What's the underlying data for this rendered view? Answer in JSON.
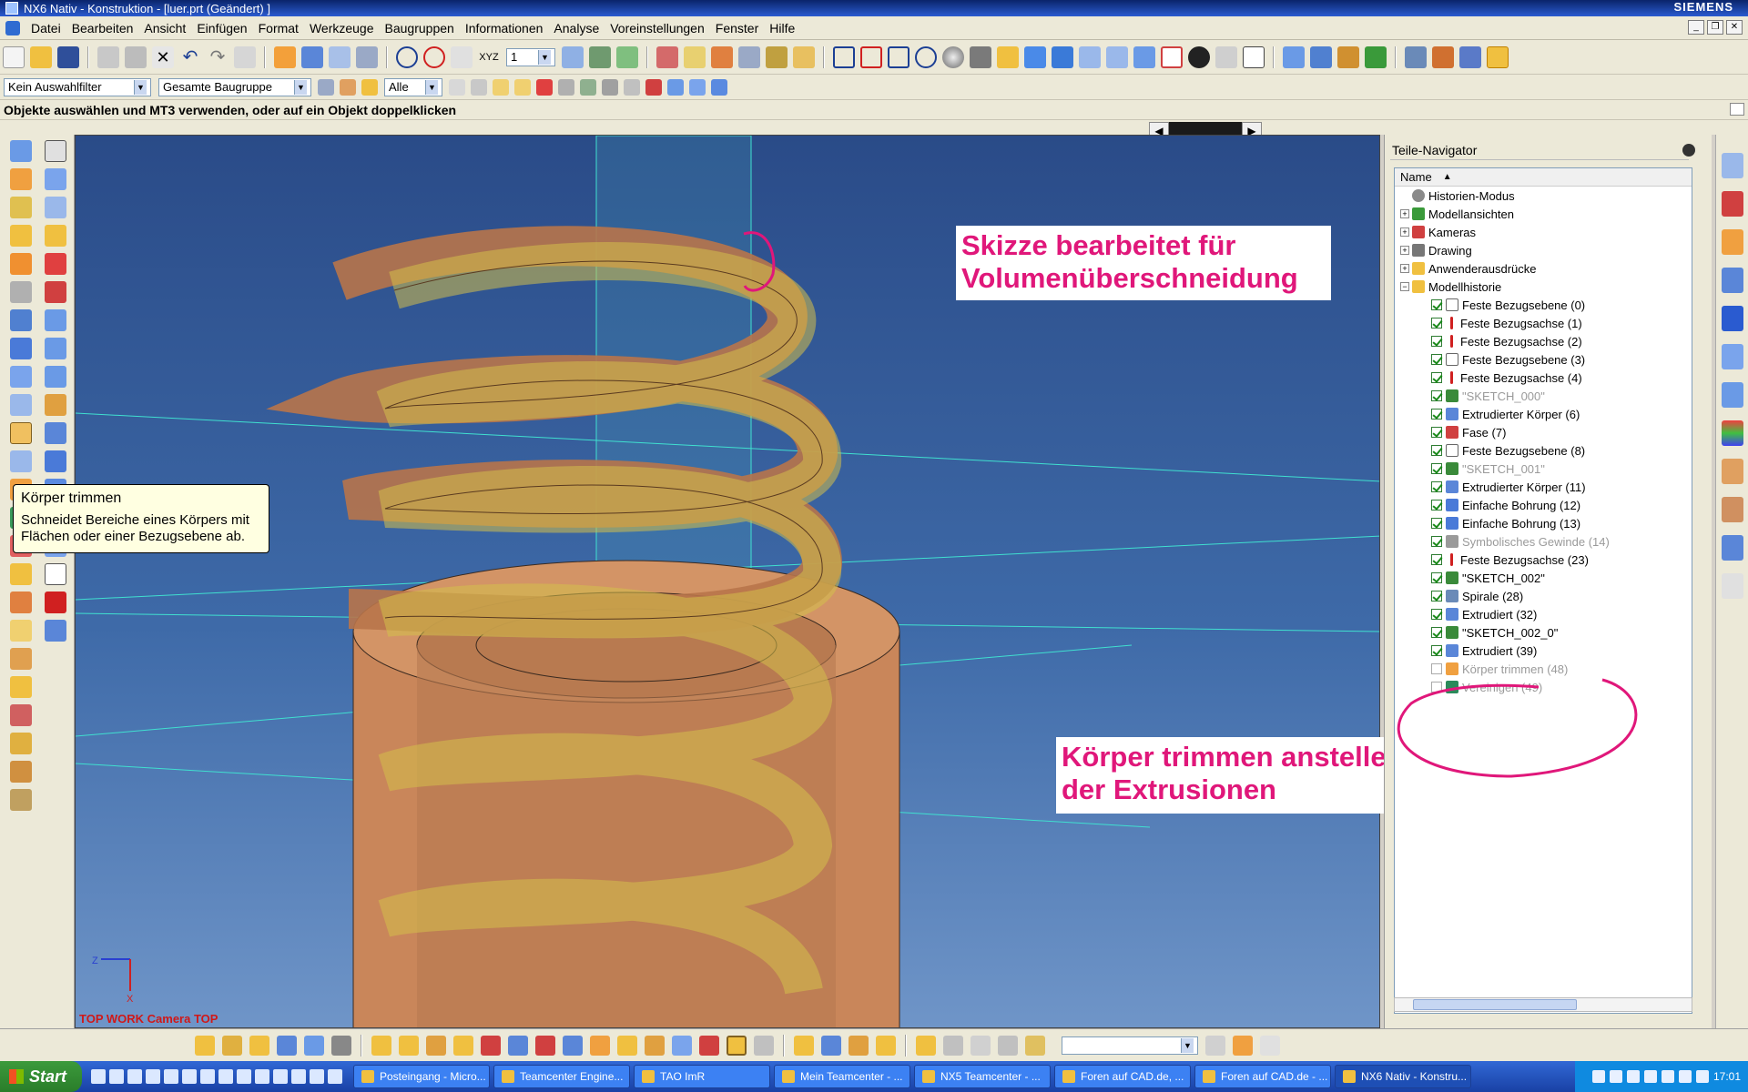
{
  "window": {
    "title": "NX6 Nativ - Konstruktion - [luer.prt (Geändert) ]",
    "brand": "SIEMENS"
  },
  "menu": [
    "Datei",
    "Bearbeiten",
    "Ansicht",
    "Einfügen",
    "Format",
    "Werkzeuge",
    "Baugruppen",
    "Informationen",
    "Analyse",
    "Voreinstellungen",
    "Fenster",
    "Hilfe"
  ],
  "selection_bar": {
    "filter": "Kein Auswahlfilter",
    "scope": "Gesamte Baugruppe",
    "type": "Alle",
    "layer": "1"
  },
  "cue_line": "Objekte auswählen und MT3 verwenden, oder auf ein Objekt doppelklicken",
  "tooltip": {
    "title": "Körper trimmen",
    "body": "Schneidet Bereiche eines Körpers mit Flächen oder einer Bezugsebene ab."
  },
  "viewport": {
    "view_label": "TOP WORK Camera TOP",
    "triad_z": "Z",
    "triad_x": "X"
  },
  "annotations": {
    "note1": "Skizze bearbeitet für Volumenüberschneidung",
    "note2": "Körper trimmen anstelle der Extrusionen",
    "highlight_color": "#e0177a"
  },
  "navigator": {
    "title": "Teile-Navigator",
    "column": "Name",
    "roots": [
      {
        "label": "Historien-Modus",
        "icon": "clock-icon"
      },
      {
        "label": "Modellansichten",
        "icon": "views-icon"
      },
      {
        "label": "Kameras",
        "icon": "camera-icon"
      },
      {
        "label": "Drawing",
        "icon": "drawing-icon"
      },
      {
        "label": "Anwenderausdrücke",
        "icon": "folder-icon"
      },
      {
        "label": "Modellhistorie",
        "icon": "folder-icon"
      }
    ],
    "history": [
      {
        "label": "Feste Bezugsebene (0)",
        "icon": "datum-plane-icon",
        "checked": true,
        "dim": false
      },
      {
        "label": "Feste Bezugsachse (1)",
        "icon": "datum-axis-icon",
        "checked": true,
        "dim": false
      },
      {
        "label": "Feste Bezugsachse (2)",
        "icon": "datum-axis-icon",
        "checked": true,
        "dim": false
      },
      {
        "label": "Feste Bezugsebene (3)",
        "icon": "datum-plane-icon",
        "checked": true,
        "dim": false
      },
      {
        "label": "Feste Bezugsachse (4)",
        "icon": "datum-axis-icon",
        "checked": true,
        "dim": false
      },
      {
        "label": "\"SKETCH_000\"",
        "icon": "sketch-icon",
        "checked": true,
        "dim": true
      },
      {
        "label": "Extrudierter Körper (6)",
        "icon": "extrude-icon",
        "checked": true,
        "dim": false
      },
      {
        "label": "Fase (7)",
        "icon": "chamfer-icon",
        "checked": true,
        "dim": false
      },
      {
        "label": "Feste Bezugsebene (8)",
        "icon": "datum-plane-icon",
        "checked": true,
        "dim": false
      },
      {
        "label": "\"SKETCH_001\"",
        "icon": "sketch-icon",
        "checked": true,
        "dim": true
      },
      {
        "label": "Extrudierter Körper (11)",
        "icon": "extrude-icon",
        "checked": true,
        "dim": false
      },
      {
        "label": "Einfache Bohrung (12)",
        "icon": "hole-icon",
        "checked": true,
        "dim": false
      },
      {
        "label": "Einfache Bohrung (13)",
        "icon": "hole-icon",
        "checked": true,
        "dim": false
      },
      {
        "label": "Symbolisches Gewinde (14)",
        "icon": "thread-icon",
        "checked": true,
        "dim": true
      },
      {
        "label": "Feste Bezugsachse (23)",
        "icon": "datum-axis-icon",
        "checked": true,
        "dim": false
      },
      {
        "label": "\"SKETCH_002\"",
        "icon": "sketch-icon",
        "checked": true,
        "dim": false
      },
      {
        "label": "Spirale (28)",
        "icon": "helix-icon",
        "checked": true,
        "dim": false
      },
      {
        "label": "Extrudiert (32)",
        "icon": "extrude-icon",
        "checked": true,
        "dim": false
      },
      {
        "label": "\"SKETCH_002_0\"",
        "icon": "sketch-icon",
        "checked": true,
        "dim": false
      },
      {
        "label": "Extrudiert (39)",
        "icon": "extrude-icon",
        "checked": true,
        "dim": false
      },
      {
        "label": "Körper trimmen (48)",
        "icon": "trim-body-icon",
        "checked": false,
        "dim": true
      },
      {
        "label": "Vereinigen (49)",
        "icon": "unite-icon",
        "checked": false,
        "dim": true
      }
    ]
  },
  "taskbar": {
    "start": "Start",
    "tasks": [
      {
        "label": "Posteingang - Micro...",
        "active": false
      },
      {
        "label": "Teamcenter Engine...",
        "active": false
      },
      {
        "label": "TAO ImR",
        "active": false
      },
      {
        "label": "Mein Teamcenter - ...",
        "active": false
      },
      {
        "label": "NX5 Teamcenter - ...",
        "active": false
      },
      {
        "label": "Foren auf CAD.de, ...",
        "active": false
      },
      {
        "label": "Foren auf CAD.de - ...",
        "active": false
      },
      {
        "label": "NX6 Nativ - Konstru...",
        "active": true
      }
    ],
    "clock": "17:01"
  }
}
